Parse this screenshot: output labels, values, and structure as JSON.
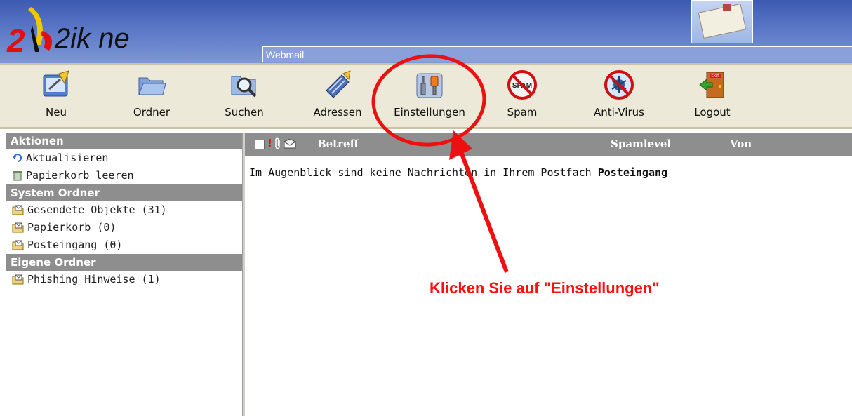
{
  "header": {
    "logo_text": "2ik net",
    "section_label": "Webmail"
  },
  "toolbar": {
    "buttons": [
      {
        "label": "Neu",
        "icon": "new-mail-icon"
      },
      {
        "label": "Ordner",
        "icon": "folder-icon"
      },
      {
        "label": "Suchen",
        "icon": "search-folder-icon"
      },
      {
        "label": "Adressen",
        "icon": "address-book-icon"
      },
      {
        "label": "Einstellungen",
        "icon": "settings-tools-icon"
      },
      {
        "label": "Spam",
        "icon": "no-spam-icon"
      },
      {
        "label": "Anti-Virus",
        "icon": "anti-virus-icon"
      },
      {
        "label": "Logout",
        "icon": "exit-door-icon"
      }
    ]
  },
  "sidebar": {
    "sections": [
      {
        "title": "Aktionen",
        "items": [
          {
            "label": "Aktualisieren",
            "icon": "refresh-icon"
          },
          {
            "label": "Papierkorb leeren",
            "icon": "trash-icon"
          }
        ]
      },
      {
        "title": "System Ordner",
        "items": [
          {
            "label": "Gesendete Objekte (31)",
            "icon": "mail-folder-icon"
          },
          {
            "label": "Papierkorb (0)",
            "icon": "mail-folder-icon"
          },
          {
            "label": "Posteingang (0)",
            "icon": "mail-folder-icon"
          }
        ]
      },
      {
        "title": "Eigene Ordner",
        "items": [
          {
            "label": "Phishing Hinweise (1)",
            "icon": "mail-folder-icon"
          }
        ]
      }
    ]
  },
  "mail_list": {
    "columns": {
      "flags": "!",
      "subject": "Betreff",
      "spamlevel": "Spamlevel",
      "from": "Von"
    },
    "empty_message": "Im Augenblick sind keine Nachrichten in Ihrem Postfach",
    "folder_name": "Posteingang"
  },
  "annotation": {
    "text": "Klicken Sie auf \"Einstellungen\"",
    "color": "#ff0f0f"
  },
  "colors": {
    "header_blue": "#3d5ab2",
    "toolbar_bg": "#ece9d8",
    "section_head_gray": "#8e8e8e",
    "logo_red": "#e01010",
    "logo_yellow": "#f0c800"
  }
}
